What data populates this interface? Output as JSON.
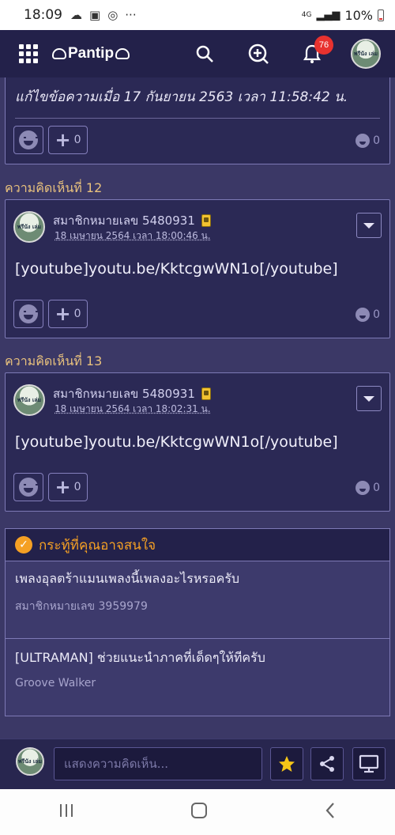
{
  "status_bar": {
    "time": "18:09",
    "network": "4G",
    "battery": "10%"
  },
  "header": {
    "logo": "Pantip",
    "notification_count": "76",
    "avatar_text": "พรีนัง เล่ม"
  },
  "top_card": {
    "edit_note": "แก้ไขข้อความเมื่อ 17 กันยายน 2563 เวลา 11:58:42 น.",
    "plus_count": "0",
    "reaction_count": "0"
  },
  "comments": [
    {
      "label": "ความคิดเห็นที่ 12",
      "user": "สมาชิกหมายเลข 5480931",
      "date": "18 เมษายน 2564 เวลา 18:00:46 น.",
      "body": "[youtube]youtu.be/KktcgwWN1o[/youtube]",
      "plus_count": "0",
      "reaction_count": "0"
    },
    {
      "label": "ความคิดเห็นที่ 13",
      "user": "สมาชิกหมายเลข 5480931",
      "date": "18 เมษายน 2564 เวลา 18:02:31 น.",
      "body": "[youtube]youtu.be/KktcgwWN1o[/youtube]",
      "plus_count": "0",
      "reaction_count": "0"
    }
  ],
  "suggested": {
    "title": "กระทู้ที่คุณอาจสนใจ",
    "items": [
      {
        "title": "เพลงอุลตร้าแมนเพลงนี้เพลงอะไรหรอครับ",
        "author": "สมาชิกหมายเลข 3959979"
      },
      {
        "title": "[ULTRAMAN] ช่วยแนะนำภาคที่เด็ดๆให้ทีครับ",
        "author": "Groove Walker"
      }
    ]
  },
  "comment_bar": {
    "placeholder": "แสดงความคิดเห็น..."
  },
  "colors": {
    "background": "#3b3866",
    "header": "#23214a",
    "accent_orange": "#f5a024",
    "comment_label": "#e8c17d",
    "badge_red": "#e8322f"
  }
}
